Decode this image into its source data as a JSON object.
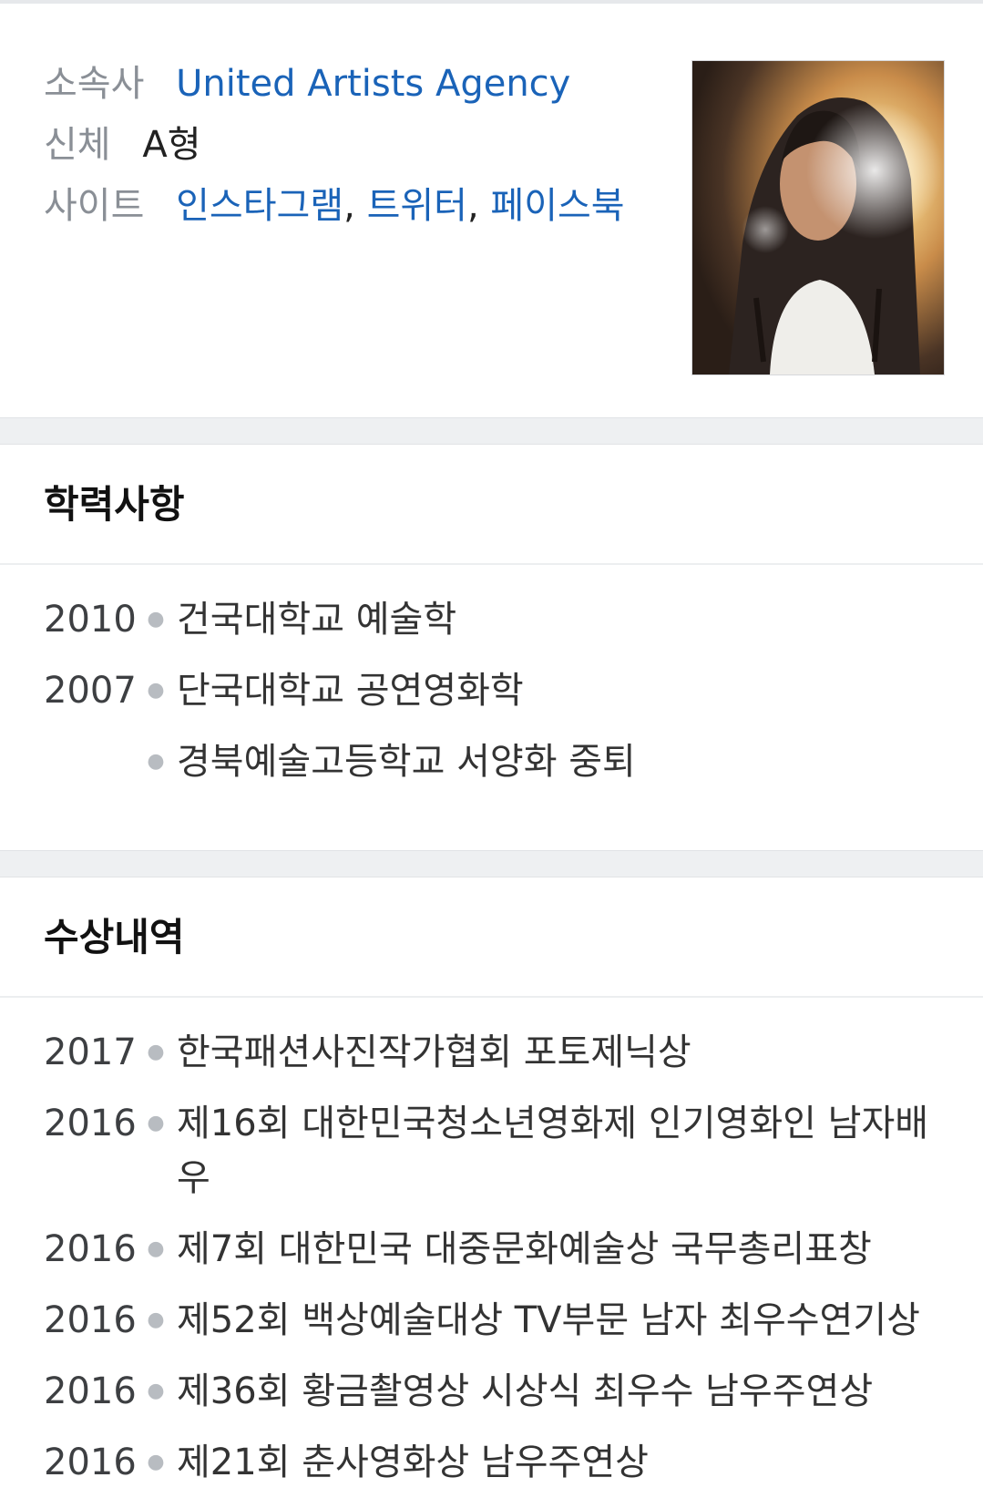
{
  "profile": {
    "agency_label": "소속사",
    "agency_value": "United Artists Agency",
    "body_label": "신체",
    "body_value": "A형",
    "site_label": "사이트",
    "sites": [
      "인스타그램",
      "트위터",
      "페이스북"
    ],
    "site_separator": ","
  },
  "education": {
    "title": "학력사항",
    "items": [
      {
        "year": "2010",
        "text": "건국대학교 예술학"
      },
      {
        "year": "2007",
        "text": "단국대학교 공연영화학"
      },
      {
        "year": "",
        "text": "경북예술고등학교 서양화 중퇴"
      }
    ]
  },
  "awards": {
    "title": "수상내역",
    "items": [
      {
        "year": "2017",
        "text": "한국패션사진작가협회 포토제닉상"
      },
      {
        "year": "2016",
        "text": "제16회 대한민국청소년영화제 인기영화인 남자배우"
      },
      {
        "year": "2016",
        "text": "제7회 대한민국 대중문화예술상 국무총리표창"
      },
      {
        "year": "2016",
        "text": "제52회 백상예술대상 TV부문 남자 최우수연기상"
      },
      {
        "year": "2016",
        "text": "제36회 황금촬영상 시상식 최우수 남우주연상"
      },
      {
        "year": "2016",
        "text": "제21회 춘사영화상 남우주연상"
      }
    ]
  },
  "colors": {
    "link": "#1a63b8",
    "label": "#8a8f96",
    "divider": "#eef0f2"
  }
}
